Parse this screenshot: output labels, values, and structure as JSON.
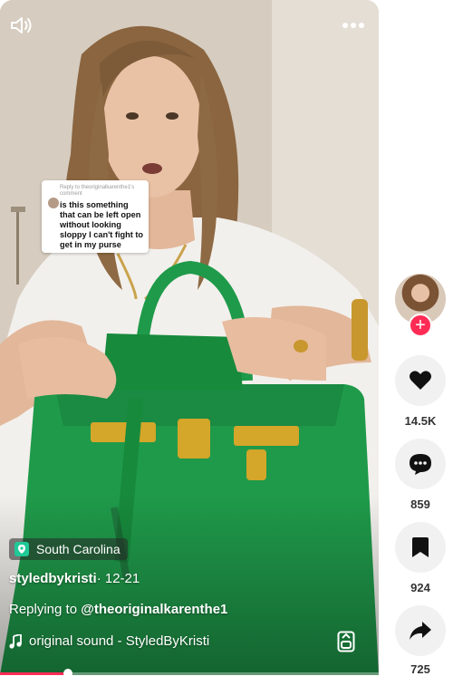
{
  "video": {
    "reply_card": {
      "header": "Reply to theoriginalkarenthe1's comment",
      "text": "is this something that can be left open without looking sloppy I can't fight to get in my purse"
    },
    "location": "South Carolina",
    "author": "styledbykristi",
    "date": " · 12-21",
    "reply_prefix": "Replying to ",
    "reply_mention": "@theoriginalkarenthe1",
    "sound": "original sound - StyledByKristi",
    "progress_fraction": 0.18,
    "icons": {
      "sound": "speaker-icon",
      "more": "more-dots-icon",
      "location": "location-pin-icon",
      "music": "music-note-icon",
      "save_sound": "save-sound-icon"
    }
  },
  "actions": {
    "follow_label": "+",
    "like_count": "14.5K",
    "comment_count": "859",
    "save_count": "924",
    "share_count": "725"
  },
  "colors": {
    "accent": "#fe2c55",
    "rail_button_bg": "#f1f1f2",
    "bag_green": "#1f9a4a",
    "location_badge": "#20c997"
  }
}
